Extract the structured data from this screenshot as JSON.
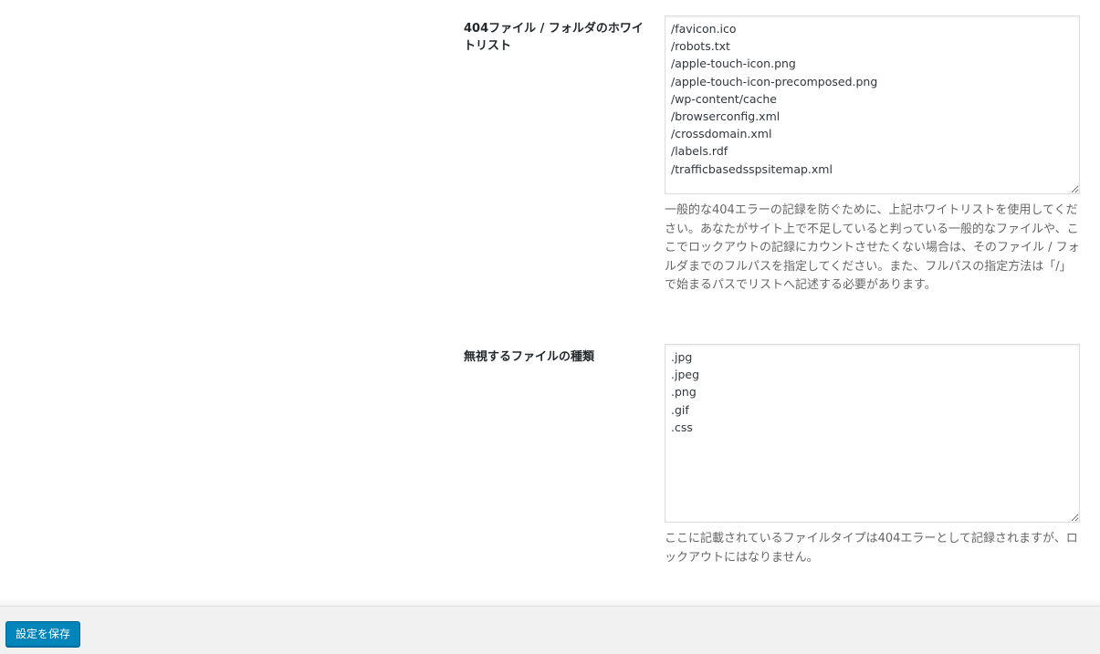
{
  "settings": {
    "whitelist": {
      "label": "404ファイル / フォルダのホワイトリスト",
      "value": "/favicon.ico\n/robots.txt\n/apple-touch-icon.png\n/apple-touch-icon-precomposed.png\n/wp-content/cache\n/browserconfig.xml\n/crossdomain.xml\n/labels.rdf\n/trafficbasedsspsitemap.xml",
      "description": "一般的な404エラーの記録を防ぐために、上記ホワイトリストを使用してください。あなたがサイト上で不足していると判っている一般的なファイルや、ここでロックアウトの記録にカウントさせたくない場合は、そのファイル / フォルダまでのフルパスを指定してください。また、フルパスの指定方法は「/」で始まるパスでリストへ記述する必要があります。"
    },
    "ignored_types": {
      "label": "無視するファイルの種類",
      "value": ".jpg\n.jpeg\n.png\n.gif\n.css",
      "description": "ここに記載されているファイルタイプは404エラーとして記録されますが、ロックアウトにはなりません。"
    }
  },
  "footer": {
    "save_label": "設定を保存"
  },
  "colors": {
    "button_bg": "#0085ba",
    "button_border": "#006799",
    "footer_bg": "#f1f1f1",
    "description_text": "#666666"
  }
}
